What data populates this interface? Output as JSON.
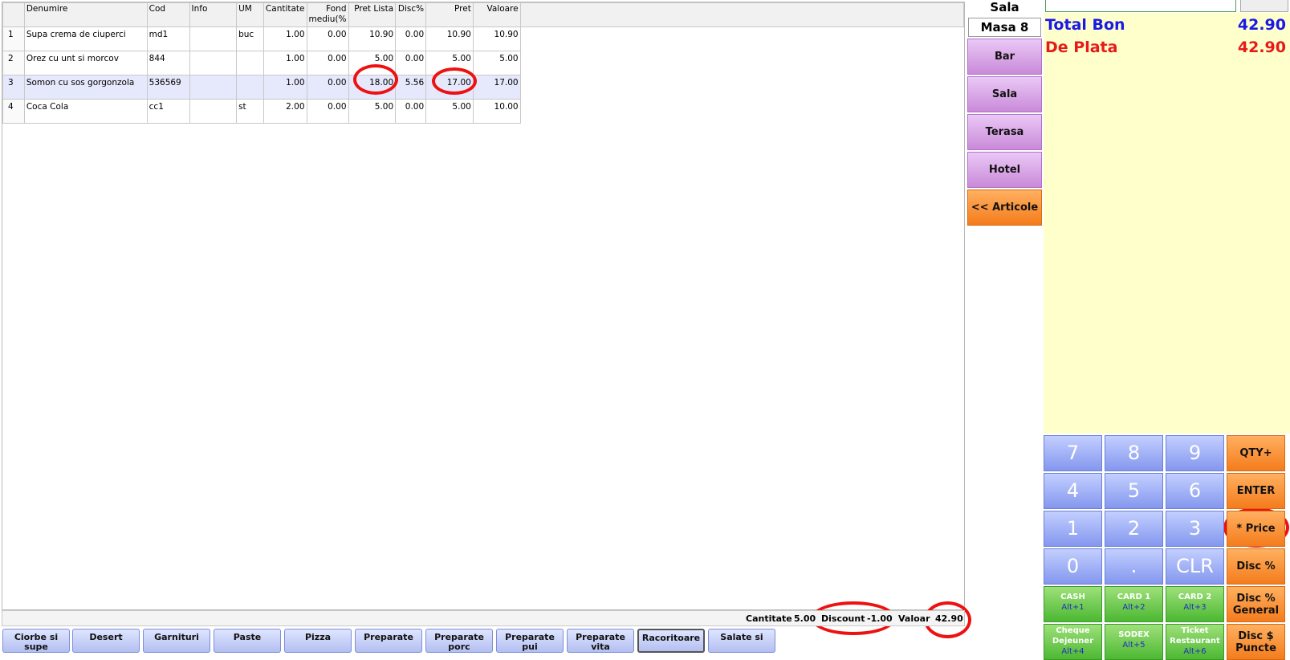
{
  "table": {
    "headers": [
      "",
      "Denumire",
      "Cod",
      "Info",
      "UM",
      "Cantitate",
      "Fond mediu(%",
      "Pret Lista",
      "Disc%",
      "Pret",
      "Valoare"
    ],
    "rows": [
      [
        "1",
        "Supa crema de ciuperci",
        "md1",
        "",
        "buc",
        "1.00",
        "0.00",
        "10.90",
        "0.00",
        "10.90",
        "10.90"
      ],
      [
        "2",
        "Orez cu unt si morcov",
        "844",
        "",
        "",
        "1.00",
        "0.00",
        "5.00",
        "0.00",
        "5.00",
        "5.00"
      ],
      [
        "3",
        "Somon cu sos gorgonzola",
        "536569",
        "",
        "",
        "1.00",
        "0.00",
        "18.00",
        "5.56",
        "17.00",
        "17.00"
      ],
      [
        "4",
        "Coca Cola",
        "cc1",
        "",
        "st",
        "2.00",
        "0.00",
        "5.00",
        "0.00",
        "5.00",
        "10.00"
      ]
    ],
    "selected_row": 3
  },
  "status": {
    "qty_label": "Cantitate",
    "qty_value": "5.00",
    "discount_label": "Discount",
    "discount_value": "-1.00",
    "value_label": "Valoar",
    "value_value": "42.90"
  },
  "categories": [
    "Ciorbe si supe",
    "Desert",
    "Garnituri",
    "Paste",
    "Pizza",
    "Preparate",
    "Preparate porc",
    "Preparate pui",
    "Preparate vita",
    "Racoritoare",
    "Salate si"
  ],
  "selected_category": "Racoritoare",
  "rooms": {
    "title": "Sala",
    "table": "Masa 8",
    "items": [
      "Bar",
      "Sala",
      "Terasa",
      "Hotel"
    ],
    "back_label": "<< Articole"
  },
  "totals": {
    "total_label": "Total Bon",
    "total_value": "42.90",
    "pay_label": "De Plata",
    "pay_value": "42.90",
    "total_color": "#1a1ae6",
    "pay_color": "#e61a1a"
  },
  "keypad": {
    "digits": [
      "7",
      "8",
      "9",
      "4",
      "5",
      "6",
      "1",
      "2",
      "3",
      "0",
      ".",
      "CLR"
    ],
    "functions": [
      "QTY+",
      "ENTER",
      "* Price",
      "Disc %",
      "Disc % General",
      "Disc $ Puncte"
    ],
    "payments": [
      {
        "label": "CASH",
        "sub": "Alt+1"
      },
      {
        "label": "CARD 1",
        "sub": "Alt+2"
      },
      {
        "label": "CARD 2",
        "sub": "Alt+3"
      },
      {
        "label": "Cheque Dejeuner",
        "sub": "Alt+4"
      },
      {
        "label": "SODEX",
        "sub": "Alt+5"
      },
      {
        "label": "Ticket Restaurant",
        "sub": "Alt+6"
      }
    ]
  }
}
